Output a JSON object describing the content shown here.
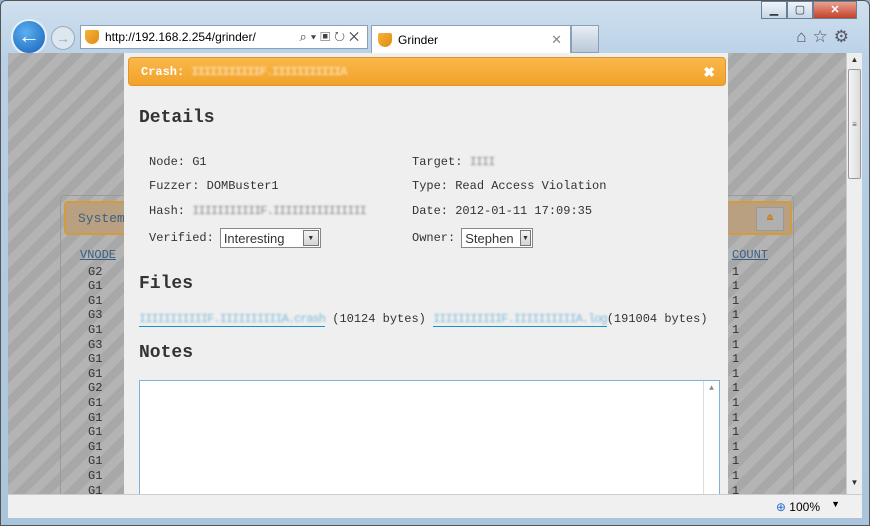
{
  "browser": {
    "url": "http://192.168.2.254/grinder/",
    "tab_title": "Grinder",
    "zoom": "100%"
  },
  "background": {
    "panel_title": "System",
    "columns": {
      "vnode": "VNODE",
      "count": "COUNT"
    },
    "vnodes": [
      "G2",
      "G1",
      "G1",
      "G3",
      "G1",
      "G3",
      "G1",
      "G1",
      "G2",
      "G1",
      "G1",
      "G1",
      "G1",
      "G1",
      "G1",
      "G1"
    ],
    "counts": [
      "1",
      "1",
      "1",
      "1",
      "1",
      "1",
      "1",
      "1",
      "1",
      "1",
      "1",
      "1",
      "1",
      "1",
      "1",
      "1"
    ]
  },
  "modal": {
    "title_prefix": "Crash:",
    "title_hash": "IIIIIIIIIIIF.IIIIIIIIIIIA",
    "details_heading": "Details",
    "node_label": "Node:",
    "node": "G1",
    "fuzzer_label": "Fuzzer:",
    "fuzzer": "DOMBuster1",
    "hash_label": "Hash:",
    "hash": "IIIIIIIIIIIF.IIIIIIIIIIIIIII",
    "verified_label": "Verified:",
    "verified": "Interesting",
    "target_label": "Target:",
    "target": "IIII",
    "type_label": "Type:",
    "type": "Read Access Violation",
    "date_label": "Date:",
    "date": "2012-01-11 17:09:35",
    "owner_label": "Owner:",
    "owner": "Stephen",
    "files_heading": "Files",
    "crash_file": "IIIIIIIIIIIF.IIIIIIIIIIA.crash",
    "crash_size": "(10124 bytes)",
    "log_file": "IIIIIIIIIIIF.IIIIIIIIIIA.log",
    "log_size": "(191004 bytes)",
    "notes_heading": "Notes",
    "notes": ""
  }
}
